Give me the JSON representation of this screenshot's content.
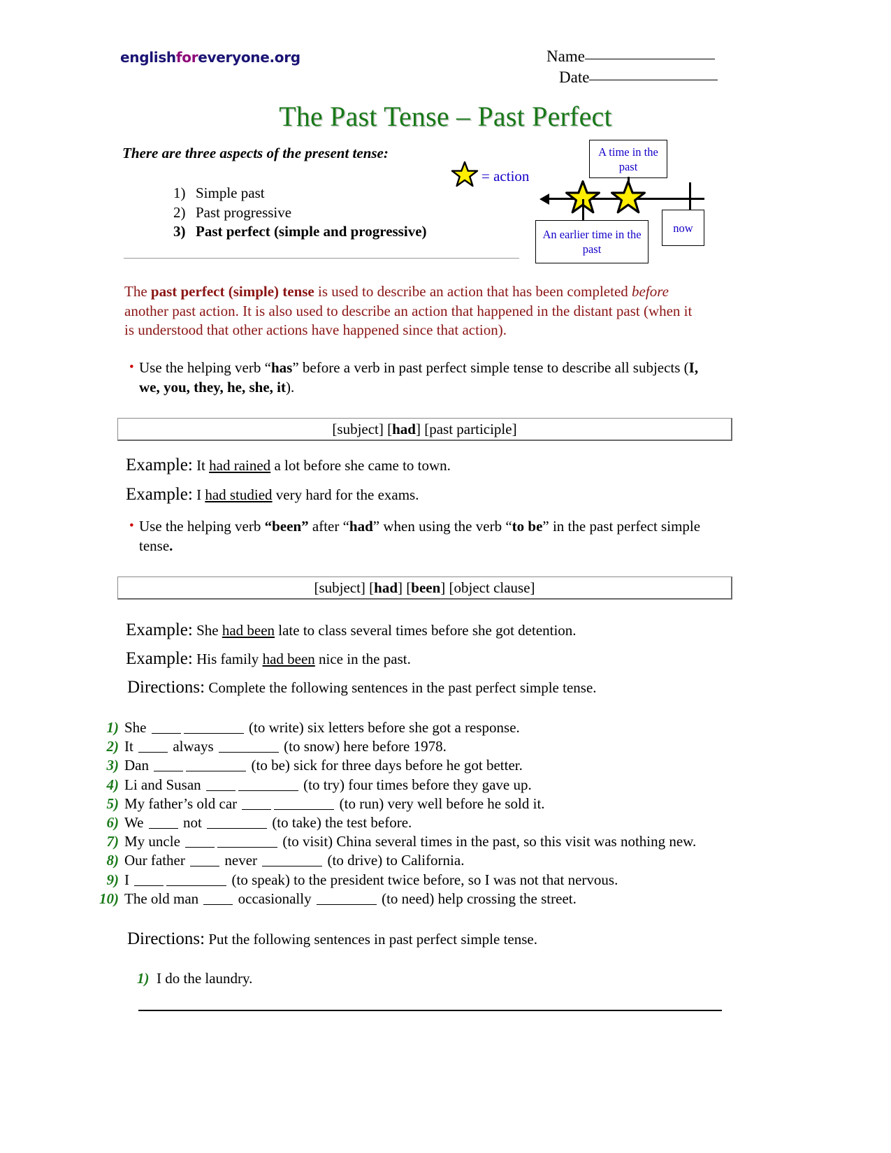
{
  "header": {
    "logo": {
      "part1": "english",
      "part2": "for",
      "part3": "everyone.org"
    },
    "name_label": "Name",
    "date_label": "Date"
  },
  "title": "The Past Tense – Past Perfect",
  "intro": {
    "lead": "There are three aspects of the present tense:",
    "aspects": [
      {
        "num": "1)",
        "label": "Simple past"
      },
      {
        "num": "2)",
        "label": "Past progressive"
      },
      {
        "num": "3)",
        "label": "Past perfect (simple and progressive)"
      }
    ]
  },
  "legend": {
    "star_label": "= action"
  },
  "diagram": {
    "box_past": "A time in the past",
    "box_earlier": "An earlier time in the past",
    "box_now": "now"
  },
  "explanation": {
    "prefix": "The ",
    "bold": "past perfect (simple) tense",
    "mid1": " is used to describe an action that has been completed ",
    "italic": "before",
    "mid2": " another past action. It is also used to describe an action that happened in the distant past (when it is understood that other actions have happened since that action)."
  },
  "bullets": [
    {
      "p1": "Use the helping verb “",
      "b1": "has",
      "p2": "” before a verb in past perfect simple tense to describe all subjects (",
      "b2": "I, we, you, they, he, she, it",
      "p3": ")."
    },
    {
      "p1": "Use the helping verb ",
      "b1": "“been”",
      "p2": " after “",
      "b2": "had",
      "p3": "” when using the verb “",
      "b3": "to be",
      "p4": "” in the past perfect simple tense",
      "b4": "."
    }
  ],
  "formulas": [
    {
      "a": "[subject]  [",
      "b": "had",
      "c": "]  [past participle]"
    },
    {
      "a": "[subject]  [",
      "b": "had",
      "c": "]  [",
      "d": "been",
      "e": "]  [object clause]"
    }
  ],
  "examples": [
    {
      "lead": "Example:",
      "pre": " It ",
      "underline": "had rained",
      "post": " a lot before she came to town."
    },
    {
      "lead": "Example:",
      "pre": " I ",
      "underline": "had studied",
      "post": " very hard for the exams."
    },
    {
      "lead": "Example:",
      "pre": " She ",
      "underline": "had been",
      "post": " late to class several times before she got detention."
    },
    {
      "lead": "Example:",
      "pre": " His family ",
      "underline": "had been",
      "post": " nice in the past."
    }
  ],
  "directions": [
    {
      "lead": "Directions:",
      "text": " Complete the following sentences in the past perfect simple tense."
    },
    {
      "lead": "Directions:",
      "text": " Put the following sentences in past perfect simple tense."
    }
  ],
  "exercises": [
    {
      "num": "1)",
      "pre": "She ",
      "mid": "",
      "post": " (to write) six letters before she got a response."
    },
    {
      "num": "2)",
      "pre": "It ",
      "mid": " always ",
      "post": " (to snow) here before 1978."
    },
    {
      "num": "3)",
      "pre": "Dan ",
      "mid": "",
      "post": " (to be) sick for three days before he got better."
    },
    {
      "num": "4)",
      "pre": "Li and Susan ",
      "mid": "",
      "post": " (to try) four times before they gave up."
    },
    {
      "num": "5)",
      "pre": "My father’s old car ",
      "mid": "",
      "post": " (to run) very well before he sold it."
    },
    {
      "num": "6)",
      "pre": "We ",
      "mid": " not ",
      "post": " (to take) the test before."
    },
    {
      "num": "7)",
      "pre": "My uncle ",
      "mid": "",
      "post": " (to visit) China several times in the past, so this visit was nothing new."
    },
    {
      "num": "8)",
      "pre": "Our father ",
      "mid": " never ",
      "post": " (to drive) to California."
    },
    {
      "num": "9)",
      "pre": "I ",
      "mid": "",
      "post": " (to speak) to the president twice before, so I was not that nervous."
    },
    {
      "num": "10)",
      "pre": "The old man ",
      "mid": " occasionally ",
      "post": " (to need) help crossing the street."
    }
  ],
  "rewrite": [
    {
      "num": "1)",
      "text": "I do the laundry."
    }
  ],
  "colors": {
    "title_green": "#187818",
    "list_number_green": "#1a7a1a",
    "explanation_red": "#8b1515",
    "bullet_red": "#cc0000",
    "diagram_blue": "#1400c8",
    "logo_navy": "#1b1474",
    "logo_purple": "#8e0a7a",
    "star_yellow": "#ffee00"
  }
}
